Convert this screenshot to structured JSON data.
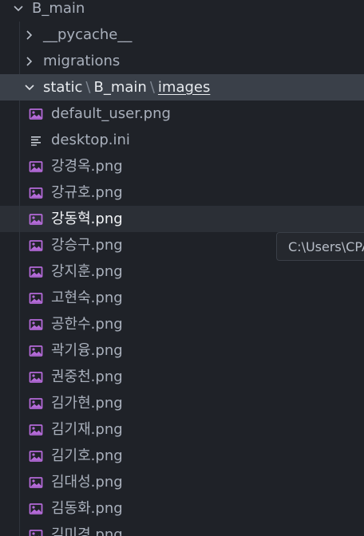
{
  "tree": {
    "root_folder": "B_main",
    "children": {
      "pycache": "__pycache__",
      "migrations": "migrations"
    },
    "path_row": {
      "seg1": "static",
      "seg2": "B_main",
      "seg3": "images"
    },
    "files": [
      "default_user.png",
      "desktop.ini",
      "강경옥.png",
      "강규호.png",
      "강동혁.png",
      "강승구.png",
      "강지훈.png",
      "고현숙.png",
      "공한수.png",
      "곽기융.png",
      "권중천.png",
      "김가현.png",
      "김기재.png",
      "김기호.png",
      "김대성.png",
      "김동화.png",
      "김미경.png"
    ]
  },
  "tooltip": {
    "text": "C:\\Users\\CPA"
  },
  "colors": {
    "image_icon": "#b46ad8",
    "background": "#1f2228",
    "selected_row": "#3a4049"
  },
  "icons": {
    "image": "image-file-icon",
    "text": "text-file-icon",
    "chevron_down": "chevron-down-icon",
    "chevron_right": "chevron-right-icon"
  }
}
